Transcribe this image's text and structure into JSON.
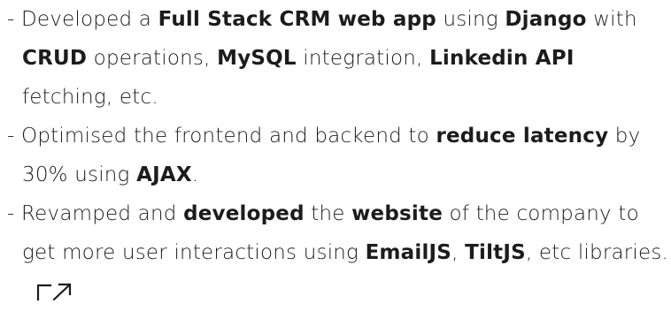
{
  "bullets": [
    {
      "parts": [
        {
          "text": "- Developed a ",
          "bold": false
        },
        {
          "text": "Full Stack CRM web app",
          "bold": true
        },
        {
          "text": " using ",
          "bold": false
        },
        {
          "text": "Django",
          "bold": true
        },
        {
          "text": " with ",
          "bold": false
        },
        {
          "text": "CRUD",
          "bold": true
        },
        {
          "text": " operations, ",
          "bold": false
        },
        {
          "text": "MySQL",
          "bold": true
        },
        {
          "text": " integration, ",
          "bold": false
        },
        {
          "text": "Linkedin API",
          "bold": true
        },
        {
          "text": " fetching, etc.",
          "bold": false
        }
      ]
    },
    {
      "parts": [
        {
          "text": "- Optimised the frontend and backend to ",
          "bold": false
        },
        {
          "text": "reduce latency",
          "bold": true
        },
        {
          "text": " by 30% using ",
          "bold": false
        },
        {
          "text": "AJAX",
          "bold": true
        },
        {
          "text": ".",
          "bold": false
        }
      ]
    },
    {
      "parts": [
        {
          "text": "- Revamped and ",
          "bold": false
        },
        {
          "text": "developed",
          "bold": true
        },
        {
          "text": " the ",
          "bold": false
        },
        {
          "text": "website",
          "bold": true
        },
        {
          "text": " of the company to get more user interactions using ",
          "bold": false
        },
        {
          "text": "EmailJS",
          "bold": true
        },
        {
          "text": ", ",
          "bold": false
        },
        {
          "text": "TiltJS",
          "bold": true
        },
        {
          "text": ", etc libraries.",
          "bold": false
        }
      ],
      "link_icon": "external-link-icon"
    }
  ],
  "colors": {
    "text": "#1c1c1c",
    "background": "#ffffff"
  }
}
